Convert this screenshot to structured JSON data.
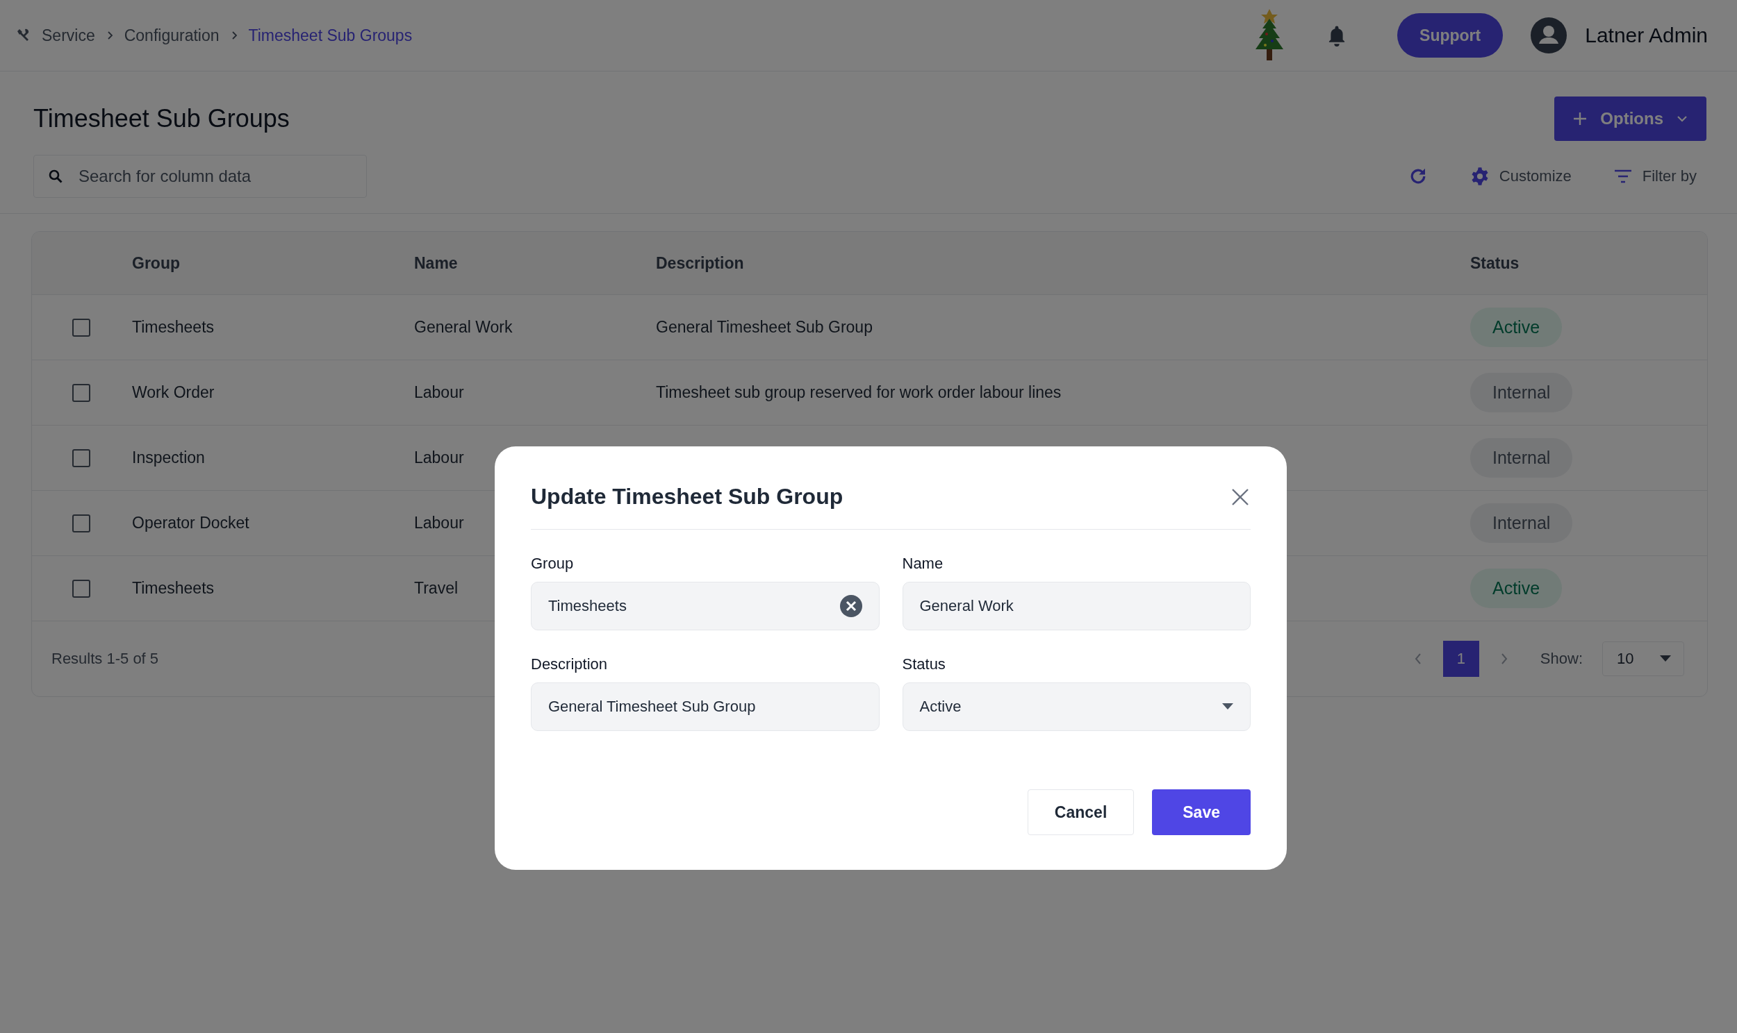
{
  "breadcrumb": [
    {
      "label": "Service",
      "selected": false
    },
    {
      "label": "Configuration",
      "selected": false
    },
    {
      "label": "Timesheet Sub Groups",
      "selected": true
    }
  ],
  "header": {
    "support_button": "Support",
    "user_name": "Latner Admin"
  },
  "page": {
    "title": "Timesheet Sub Groups",
    "options_button": "Options",
    "search": {
      "placeholder": "Search for column data"
    },
    "toolbar": [
      {
        "kind": "refresh"
      },
      {
        "kind": "customize",
        "label": "Customize"
      },
      {
        "kind": "filter",
        "label": "Filter by"
      }
    ]
  },
  "table": {
    "columns": [
      "Group",
      "Name",
      "Description",
      "Status"
    ],
    "rows": [
      {
        "checked": false,
        "group": "Timesheets",
        "name": "General Work",
        "description": "General Timesheet Sub Group",
        "status": "Active",
        "kind": "active"
      },
      {
        "checked": false,
        "group": "Work Order",
        "name": "Labour",
        "description": "Timesheet sub group reserved for work order labour lines",
        "status": "Internal",
        "kind": "internal"
      },
      {
        "checked": false,
        "group": "Inspection",
        "name": "Labour",
        "status": "Internal",
        "kind": "internal"
      },
      {
        "checked": false,
        "group": "Operator Docket",
        "name": "Labour",
        "status": "Internal",
        "kind": "internal"
      },
      {
        "checked": false,
        "group": "Timesheets",
        "name": "Travel",
        "status": "Active",
        "kind": "active"
      }
    ],
    "results": "Results 1-5 of 5",
    "pages": [
      {
        "label": "1",
        "selected": true
      }
    ],
    "show_label": "Show:",
    "page_size": "10"
  },
  "dialog": {
    "title": "Update Timesheet Sub Group",
    "fields": [
      {
        "label": "Group",
        "value": "Timesheets",
        "kind": "clearable"
      },
      {
        "label": "Name",
        "value": "General Work",
        "kind": "text"
      },
      {
        "label": "Description",
        "value": "General Timesheet Sub Group",
        "kind": "text"
      },
      {
        "label": "Status",
        "value": "Active",
        "kind": "select"
      }
    ],
    "buttons": [
      {
        "label": "Cancel",
        "kind": "secondary"
      },
      {
        "label": "Save",
        "kind": "primary"
      }
    ]
  }
}
